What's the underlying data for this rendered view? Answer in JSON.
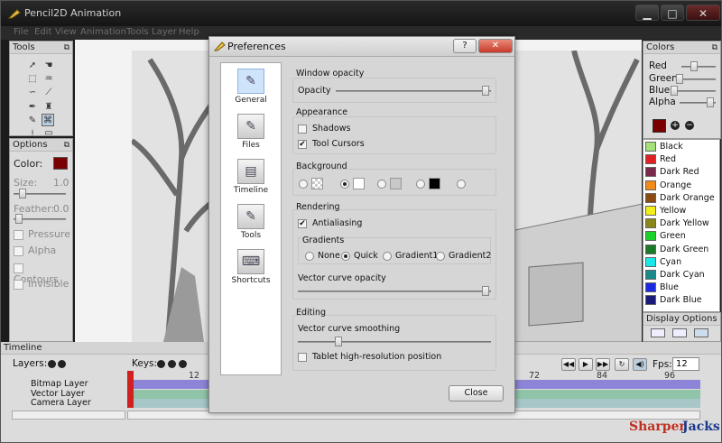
{
  "app": {
    "title": "Pencil2D Animation",
    "minimize": "▁",
    "maximize": "□",
    "close": "✕"
  },
  "menu": [
    "File",
    "Edit",
    "View",
    "Animation",
    "Tools",
    "Layer",
    "Help"
  ],
  "tools_panel": {
    "title": "Tools",
    "float_icon": "⧉"
  },
  "options_panel": {
    "title": "Options",
    "color_label": "Color:",
    "color_value": "#7a0000",
    "size_label": "Size:",
    "size_value": "1.0",
    "feather_label": "Feather:",
    "feather_value": "0.0",
    "checks": [
      "Pressure",
      "Alpha",
      "Contours",
      "Invisible"
    ]
  },
  "colors_panel": {
    "title": "Colors",
    "sliders": [
      "Red",
      "Green",
      "Blue",
      "Alpha"
    ],
    "current_color": "#7a0000",
    "add": "+",
    "remove": "−",
    "list": [
      {
        "name": "Black",
        "hex": "#a6e07a"
      },
      {
        "name": "Red",
        "hex": "#e02020"
      },
      {
        "name": "Dark Red",
        "hex": "#7a2a4a"
      },
      {
        "name": "Orange",
        "hex": "#f28a1a"
      },
      {
        "name": "Dark Orange",
        "hex": "#8a4a10"
      },
      {
        "name": "Yellow",
        "hex": "#f2ee1a"
      },
      {
        "name": "Dark Yellow",
        "hex": "#8a861a"
      },
      {
        "name": "Green",
        "hex": "#1ad22a"
      },
      {
        "name": "Dark Green",
        "hex": "#1a7a2a"
      },
      {
        "name": "Cyan",
        "hex": "#1ae8e8"
      },
      {
        "name": "Dark Cyan",
        "hex": "#1a8a8a"
      },
      {
        "name": "Blue",
        "hex": "#1a2ae0"
      },
      {
        "name": "Dark Blue",
        "hex": "#1a1a7a"
      }
    ]
  },
  "display_panel": {
    "title": "Display Options"
  },
  "timeline": {
    "title": "Timeline",
    "layers_label": "Layers:",
    "keys_label": "Keys:",
    "layers": [
      "Bitmap Layer",
      "Vector Layer",
      "Camera Layer"
    ],
    "ticks": [
      "12",
      "72",
      "84",
      "96"
    ],
    "fps_label": "Fps:",
    "fps_value": "12",
    "playback": [
      "◀◀",
      "▶",
      "▶▶",
      "↻",
      "◀)"
    ]
  },
  "dialog": {
    "title": "Preferences",
    "help": "?",
    "close": "✕",
    "nav": [
      {
        "label": "General",
        "icon": "✎"
      },
      {
        "label": "Files",
        "icon": "✎"
      },
      {
        "label": "Timeline",
        "icon": "▤"
      },
      {
        "label": "Tools",
        "icon": "✎"
      },
      {
        "label": "Shortcuts",
        "icon": "⌨"
      }
    ],
    "window_opacity": {
      "group": "Window opacity",
      "label": "Opacity",
      "value": 100
    },
    "appearance": {
      "group": "Appearance",
      "shadows": "Shadows",
      "shadows_checked": false,
      "tool_cursors": "Tool Cursors",
      "tool_cursors_checked": true
    },
    "background": {
      "group": "Background",
      "swatches": [
        "#e8e8e8",
        "#ffffff",
        "#c8c8c8",
        "#000000",
        "#d6d6d6"
      ],
      "selected": 1
    },
    "rendering": {
      "group": "Rendering",
      "antialiasing": "Antialiasing",
      "antialiasing_checked": true,
      "gradients_label": "Gradients",
      "gradients": [
        "None",
        "Quick",
        "Gradient1",
        "Gradient2"
      ],
      "gradient_selected": 1,
      "vector_opacity_label": "Vector curve opacity",
      "vector_opacity_value": 100
    },
    "editing": {
      "group": "Editing",
      "smoothing_label": "Vector curve smoothing",
      "smoothing_value": 20,
      "tablet_label": "Tablet high-resolution position",
      "tablet_checked": false
    },
    "close_button": "Close",
    "check_mark": "✔"
  },
  "watermark": {
    "part1": "Sharper",
    "part2": "Jacks"
  }
}
